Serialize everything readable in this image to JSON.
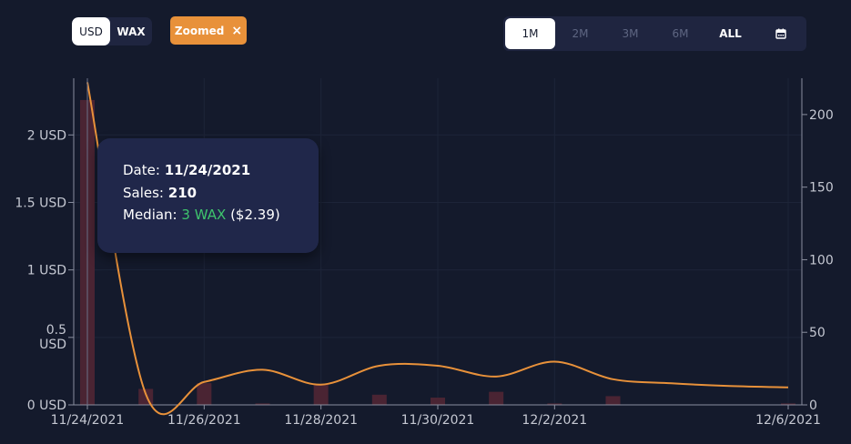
{
  "currency_toggle": {
    "usd_label": "USD",
    "wax_label": "WAX",
    "selected": "USD"
  },
  "zoom_chip": {
    "label": "Zoomed",
    "close_glyph": "×"
  },
  "range_tabs": {
    "items": [
      "1M",
      "2M",
      "3M",
      "6M",
      "ALL"
    ],
    "selected": "1M",
    "calendar_icon": "calendar-icon"
  },
  "tooltip": {
    "date_label": "Date:",
    "date_value": "11/24/2021",
    "sales_label": "Sales:",
    "sales_value": "210",
    "median_label": "Median:",
    "median_wax": "3 WAX",
    "median_usd": "($2.39)"
  },
  "colors": {
    "background": "#141a2c",
    "accent_orange": "#e8913a",
    "bar_fill": "#4a2433",
    "median_green": "#3ec46d",
    "tooltip_bg": "#20274a"
  },
  "chart_data": {
    "type": "bar",
    "title": "",
    "x_tick_labels": [
      "11/24/2021",
      "11/26/2021",
      "11/28/2021",
      "11/30/2021",
      "12/2/2021",
      "12/6/2021"
    ],
    "x_tick_days": [
      0,
      2,
      4,
      6,
      8,
      12
    ],
    "xlim_days": [
      0,
      12
    ],
    "left_axis": {
      "ticks": [
        "0 USD",
        "0.5 USD",
        "1 USD",
        "1.5 USD",
        "2 USD"
      ],
      "tick_values": [
        0,
        0.5,
        1,
        1.5,
        2
      ],
      "ylim": [
        0,
        2.42
      ]
    },
    "right_axis": {
      "ticks": [
        "0",
        "50",
        "100",
        "150",
        "200"
      ],
      "tick_values": [
        0,
        50,
        100,
        150,
        200
      ],
      "ylim": [
        0,
        225
      ]
    },
    "series": [
      {
        "kind": "bar",
        "axis": "right",
        "x_days": [
          0,
          1,
          2,
          3,
          4,
          5,
          6,
          7,
          8,
          9,
          12
        ],
        "values": [
          210,
          11,
          15,
          1,
          14,
          7,
          5,
          9,
          1,
          6,
          1
        ]
      },
      {
        "kind": "line",
        "axis": "left",
        "x_days": [
          0,
          1,
          2,
          3,
          4,
          5,
          6,
          7,
          8,
          9,
          10,
          11,
          12
        ],
        "values": [
          2.39,
          0.08,
          0.17,
          0.26,
          0.15,
          0.29,
          0.29,
          0.21,
          0.32,
          0.19,
          0.16,
          0.14,
          0.13
        ]
      }
    ],
    "grid": true,
    "crosshair_x_day": 0
  }
}
